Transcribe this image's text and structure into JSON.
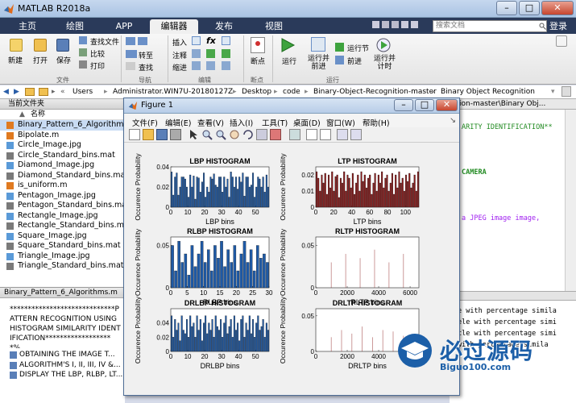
{
  "window": {
    "title": "MATLAB R2018a",
    "min": "–",
    "max": "□",
    "close": "✕"
  },
  "tabs": [
    {
      "label": "主页"
    },
    {
      "label": "绘图"
    },
    {
      "label": "APP"
    },
    {
      "label": "编辑器"
    },
    {
      "label": "发布"
    },
    {
      "label": "视图"
    }
  ],
  "search_placeholder": "搜索文档",
  "login": "登录",
  "toolstrip": {
    "new": "新建",
    "open": "打开",
    "save": "保存",
    "find_files": "查找文件",
    "compare": "比较",
    "print": "打印",
    "insert": "插入",
    "comment": "注释",
    "indent": "缩进",
    "goto": "转至",
    "find": "查找",
    "breakpoints": "断点",
    "run": "运行",
    "run_advance": "运行并\n前进",
    "run_section": "运行节",
    "advance": "前进",
    "run_time": "运行并\n计时",
    "fx": "fx",
    "groups": {
      "file": "文件",
      "nav": "导航",
      "edit": "编辑",
      "bp": "断点",
      "run": "运行"
    }
  },
  "path": {
    "parts": [
      "Users",
      "Administrator.WIN7U-20180127Z",
      "Desktop",
      "code",
      "Binary-Object-Recognition-master",
      "Binary Object Recognition"
    ]
  },
  "curdir": {
    "title": "当前文件夹",
    "col_name": "名称",
    "files": [
      "Binary_Pattern_6_Algorithms.m",
      "Bipolate.m",
      "Circle_Image.jpg",
      "Circle_Standard_bins.mat",
      "Diamond_Image.jpg",
      "Diamond_Standard_bins.mat",
      "is_uniform.m",
      "Pentagon_Image.jpg",
      "Pentagon_Standard_bins.mat",
      "Rectangle_Image.jpg",
      "Rectangle_Standard_bins.mat",
      "Square_Image.jpg",
      "Square_Standard_bins.mat",
      "Triangle_Image.jpg",
      "Triangle_Standard_bins.mat"
    ]
  },
  "detail": {
    "title": "Binary_Pattern_6_Algorithms.m",
    "text": "*****************************PATTERN RECOGNITION USING HISTOGRAM SIMILARITY IDENTIFICATION*******************%",
    "items": [
      "OBTAINING THE IMAGE T...",
      "ALGORITHM'S I, II, III, IV &...",
      "DISPLAY THE LBP, RLBP, LT..."
    ]
  },
  "editor": {
    "top_path": "ion-master\\Binary Obj...",
    "lines": [
      {
        "text": "ARITY IDENTIFICATION**",
        "color": "#228b22"
      },
      {
        "text": "CAMERA",
        "color": "#228b22"
      },
      {
        "text": "a JPEG image image,",
        "color": "#a020f0"
      },
      {
        "text": "e with percentage simila",
        "color": "#000000"
      },
      {
        "text": "ele with percentage simi",
        "color": "#000000"
      },
      {
        "text": "cle with percentage simi",
        "color": "#000000"
      },
      {
        "text": "with percentage simila",
        "color": "#000000"
      }
    ]
  },
  "figure": {
    "title": "Figure 1",
    "menu": [
      "文件(F)",
      "编辑(E)",
      "查看(V)",
      "插入(I)",
      "工具(T)",
      "桌面(D)",
      "窗口(W)",
      "帮助(H)"
    ]
  },
  "chart_data": [
    {
      "type": "bar",
      "title": "LBP HISTOGRAM",
      "xlabel": "LBP bins",
      "ylabel": "Occurence Probability",
      "xlim": [
        0,
        58
      ],
      "ylim": [
        0,
        0.04
      ],
      "xticks": [
        0,
        10,
        20,
        30,
        40,
        50
      ],
      "yticks": [
        0,
        0.02,
        0.04
      ],
      "color": "#1f5aa6",
      "values": [
        0.035,
        0.012,
        0.03,
        0.034,
        0.012,
        0.02,
        0.03,
        0.03,
        0.028,
        0.02,
        0.01,
        0.032,
        0.02,
        0.031,
        0.008,
        0.03,
        0.029,
        0.015,
        0.025,
        0.034,
        0.01,
        0.02,
        0.015,
        0.03,
        0.028,
        0.033,
        0.022,
        0.02,
        0.03,
        0.03,
        0.015,
        0.03,
        0.02,
        0.028,
        0.01,
        0.035,
        0.03,
        0.02,
        0.03,
        0.018,
        0.03,
        0.025,
        0.034,
        0.011,
        0.03,
        0.03,
        0.02,
        0.022,
        0.034,
        0.01,
        0.02,
        0.03,
        0.028,
        0.02,
        0.03,
        0.015,
        0.032,
        0.02
      ]
    },
    {
      "type": "bar",
      "title": "LTP HISTOGRAM",
      "xlabel": "LTP bins",
      "ylabel": "Occurence Probability",
      "xlim": [
        0,
        115
      ],
      "ylim": [
        0,
        0.025
      ],
      "xticks": [
        0,
        20,
        40,
        60,
        80,
        100
      ],
      "yticks": [
        0,
        0.01,
        0.02
      ],
      "color": "#8b1a1a",
      "values": [
        0.022,
        0.018,
        0.01,
        0.02,
        0.015,
        0.021,
        0.008,
        0.02,
        0.012,
        0.022,
        0.01,
        0.019,
        0.02,
        0.006,
        0.018,
        0.015,
        0.022,
        0.01,
        0.02,
        0.018,
        0.012,
        0.021,
        0.008,
        0.015,
        0.02,
        0.01,
        0.022,
        0.016,
        0.02,
        0.012,
        0.018,
        0.02,
        0.008,
        0.015,
        0.021,
        0.01,
        0.02,
        0.015,
        0.022,
        0.012,
        0.018,
        0.02,
        0.01,
        0.015,
        0.021,
        0.008,
        0.02,
        0.012,
        0.022,
        0.015,
        0.018,
        0.01,
        0.02,
        0.016,
        0.021,
        0.012,
        0.015,
        0.02,
        0.01,
        0.022
      ]
    },
    {
      "type": "bar",
      "title": "RLBP HISTOGRAM",
      "xlabel": "RLBP bins",
      "ylabel": "Occurence Probability",
      "xlim": [
        0,
        30
      ],
      "ylim": [
        0,
        0.06
      ],
      "xticks": [
        0,
        5,
        10,
        15,
        20,
        25,
        30
      ],
      "yticks": [
        0,
        0.05
      ],
      "color": "#1f5aa6",
      "values": [
        0.05,
        0.02,
        0.055,
        0.03,
        0.04,
        0.015,
        0.05,
        0.025,
        0.04,
        0.055,
        0.03,
        0.045,
        0.02,
        0.05,
        0.035,
        0.055,
        0.025,
        0.045,
        0.03,
        0.05,
        0.02,
        0.04,
        0.055,
        0.03,
        0.045,
        0.02,
        0.05,
        0.035,
        0.04,
        0.03
      ]
    },
    {
      "type": "bar",
      "title": "RLTP HISTOGRAM",
      "xlabel": "RLTP bins",
      "ylabel": "Occurence Probability",
      "xlim": [
        0,
        6561
      ],
      "ylim": [
        0,
        0.06
      ],
      "xticks": [
        0,
        2000,
        4000,
        6000
      ],
      "yticks": [
        0,
        0.05
      ],
      "color": "#8b1a1a",
      "values": [
        0.03,
        0.04,
        0.035,
        0.045,
        0.03,
        0.04
      ]
    },
    {
      "type": "bar",
      "title": "DRLBP HISTOGRAM",
      "xlabel": "DRLBP bins",
      "ylabel": "Occurence Probability",
      "xlim": [
        0,
        58
      ],
      "ylim": [
        0,
        0.06
      ],
      "xticks": [
        0,
        10,
        20,
        30,
        40,
        50
      ],
      "yticks": [
        0,
        0.02,
        0.04
      ],
      "color": "#1f5aa6",
      "values": [
        0.05,
        0.02,
        0.045,
        0.03,
        0.04,
        0.015,
        0.05,
        0.03,
        0.025,
        0.045,
        0.02,
        0.05,
        0.035,
        0.04,
        0.02,
        0.05,
        0.03,
        0.045,
        0.015,
        0.04,
        0.05,
        0.025,
        0.04,
        0.03,
        0.045,
        0.02,
        0.05,
        0.035,
        0.03,
        0.045,
        0.02,
        0.04,
        0.05,
        0.025,
        0.035,
        0.045,
        0.02,
        0.05,
        0.03,
        0.04,
        0.015,
        0.045,
        0.05,
        0.02,
        0.04,
        0.03,
        0.05,
        0.025,
        0.045,
        0.02,
        0.04,
        0.05,
        0.03,
        0.035,
        0.045,
        0.02,
        0.04,
        0.03
      ]
    },
    {
      "type": "bar",
      "title": "DRLTP HISTOGRAM",
      "xlabel": "DRLTP bins",
      "ylabel": "Occurence Probability",
      "xlim": [
        0,
        6561
      ],
      "ylim": [
        0,
        0.06
      ],
      "xticks": [
        0,
        2000,
        4000,
        6000
      ],
      "yticks": [
        0,
        0.05
      ],
      "color": "#8b1a1a",
      "values": [
        0.02,
        0.03,
        0.025,
        0.035,
        0.02,
        0.03,
        0.028,
        0.022
      ]
    }
  ],
  "watermark": {
    "text": "必过源码",
    "url": "Biguo100.com"
  },
  "colors": {
    "accent": "#2a3a5a",
    "window": "#f0f0f0",
    "chart_blue": "#1f5aa6",
    "chart_red": "#8b1a1a"
  }
}
